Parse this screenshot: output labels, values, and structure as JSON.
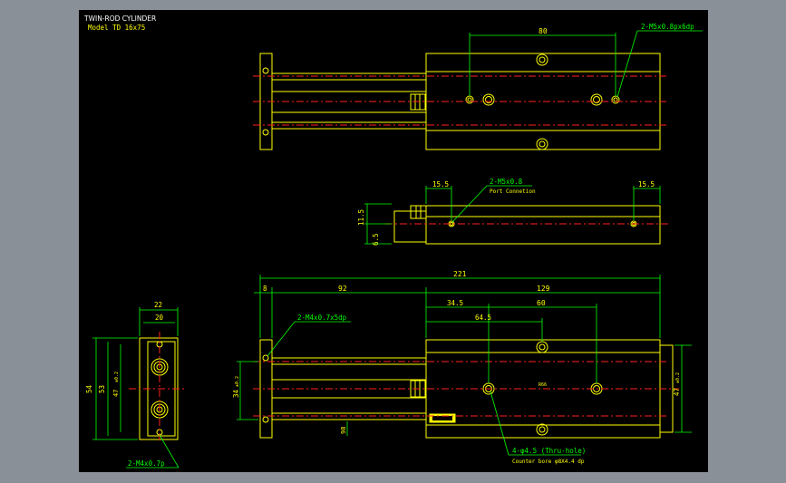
{
  "title": {
    "line1": "TWIN-ROD CYLINDER",
    "line2": "Model TD 16x75"
  },
  "top_view": {
    "dim_80": "80",
    "callout_port": "2-M5x0.8px6dp"
  },
  "side_view": {
    "dim_15_5_left": "15.5",
    "dim_15_5_right": "15.5",
    "dim_11_5": "11.5",
    "dim_6_5": "6.5",
    "callout_port": "2-M5x0.8",
    "callout_port_sub": "Port Connetion"
  },
  "end_view": {
    "dim_22": "22",
    "dim_20": "20",
    "dim_54": "54",
    "dim_53": "53",
    "dim_47": "47",
    "dim_47_tol": "±0.2",
    "callout_tap": "2-M4x0.7p"
  },
  "front_view": {
    "dim_221": "221",
    "dim_8": "8",
    "dim_92": "92",
    "dim_129": "129",
    "dim_34_5": "34.5",
    "dim_60": "60",
    "dim_64_5": "64.5",
    "dim_34": "34",
    "dim_34_tol": "±0.2",
    "dim_47": "47",
    "dim_47_tol": "±0.2",
    "dim_98": "98",
    "center_label": "R66",
    "callout_tap": "2-M4x0.7x5dp",
    "callout_holes": "4-φ4.5 (Thru-hole)",
    "callout_holes_sub": "Counter bore φ8X4.4 dp"
  }
}
